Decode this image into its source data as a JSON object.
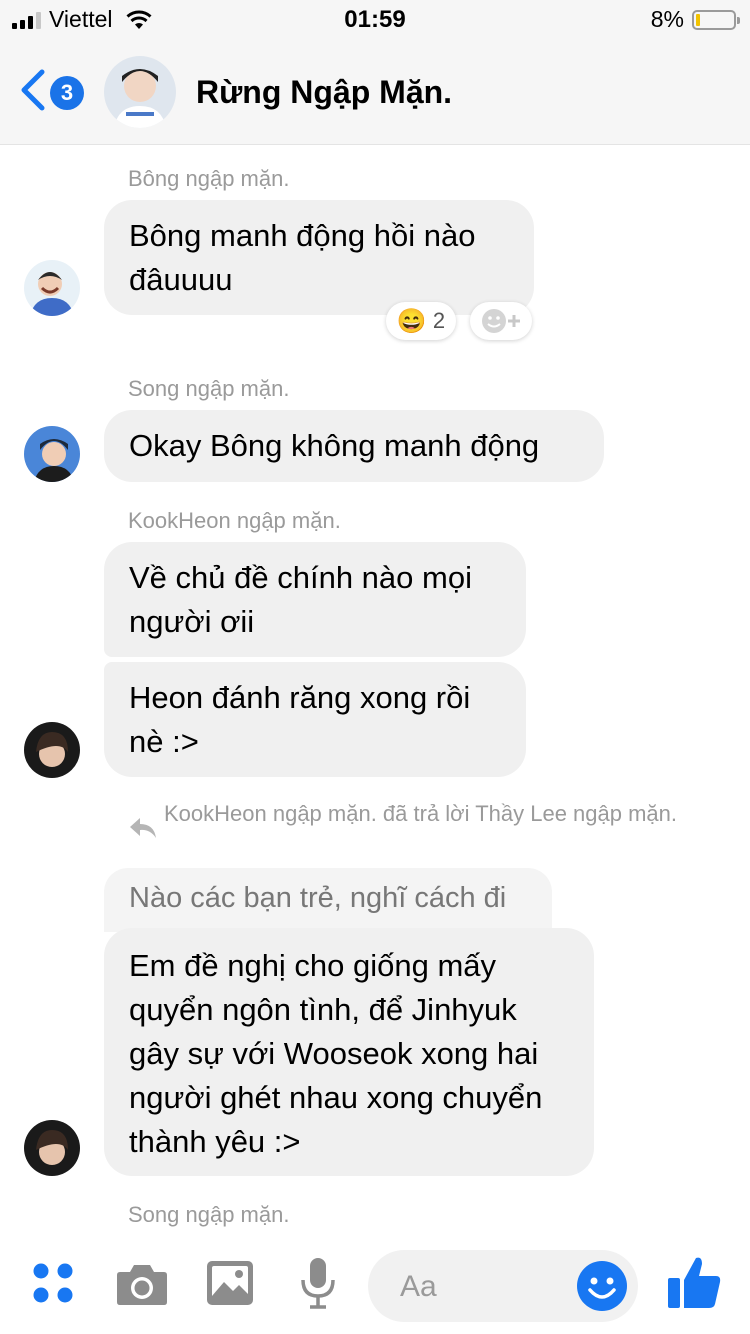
{
  "status_bar": {
    "carrier": "Viettel",
    "time": "01:59",
    "battery_percent": "8%",
    "battery_level": 0.08
  },
  "header": {
    "unread_count": "3",
    "title": "Rừng Ngập Mặn.",
    "back_icon": "chevron-left-icon"
  },
  "messages": [
    {
      "sender": "Bông ngập mặn.",
      "text": "Bông manh động hồi nào đâuuuu",
      "reaction_emoji": "😄",
      "reaction_count": "2"
    },
    {
      "sender": "Song ngập mặn.",
      "text": "Okay Bông không manh động"
    },
    {
      "sender": "KookHeon ngập mặn.",
      "texts": [
        "Về chủ đề chính nào mọi người ơii",
        "Heon đánh răng xong rồi nè :>"
      ]
    },
    {
      "reply_note": "KookHeon ngập mặn. đã trả lời Thầy Lee ngập mặn.",
      "quoted": "Nào các bạn trẻ, nghĩ cách đi",
      "text": "Em đề nghị cho giống mấy quyển ngôn tình, để Jinhyuk gây sự với Wooseok xong hai người ghét nhau xong chuyển thành yêu :>"
    },
    {
      "sender": "Song ngập mặn."
    }
  ],
  "composer": {
    "placeholder": "Aa",
    "icons": [
      "apps-icon",
      "camera-icon",
      "image-icon",
      "microphone-icon",
      "emoji-icon",
      "thumbs-up-icon"
    ]
  },
  "colors": {
    "accent": "#1877f2",
    "bubble": "#f0f0f0",
    "muted_text": "#9a9a9a"
  }
}
